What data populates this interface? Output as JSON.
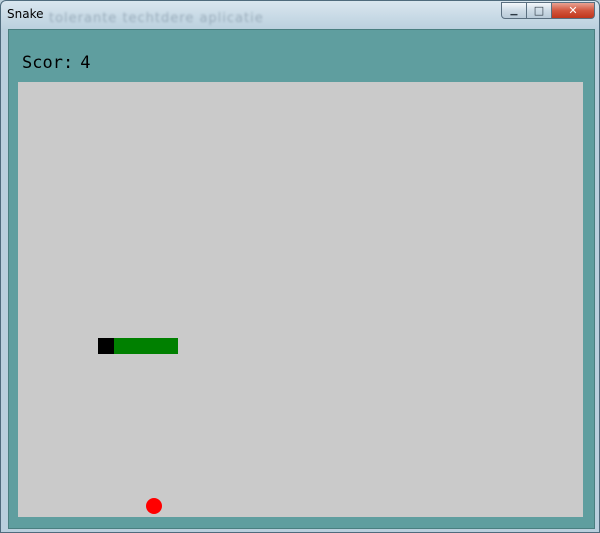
{
  "window": {
    "title": "Snake",
    "background_title": "tolerante  techtdere aplicatie",
    "buttons": [
      {
        "name": "minimize",
        "glyph": "▁"
      },
      {
        "name": "maximize",
        "glyph": "□"
      },
      {
        "name": "close",
        "glyph": "✕"
      }
    ]
  },
  "game": {
    "score_label": "Scor:",
    "score": "4",
    "grid_cell": 16,
    "colors": {
      "client_background": "#5f9e9f",
      "board": "#cacaca",
      "snake_head": "#000000",
      "snake_body": "#008000",
      "food": "#ff0000"
    },
    "snake": [
      {
        "col": 5,
        "row": 16
      },
      {
        "col": 6,
        "row": 16
      },
      {
        "col": 7,
        "row": 16
      },
      {
        "col": 8,
        "row": 16
      },
      {
        "col": 9,
        "row": 16
      }
    ],
    "food": {
      "col": 8,
      "row": 26
    }
  }
}
